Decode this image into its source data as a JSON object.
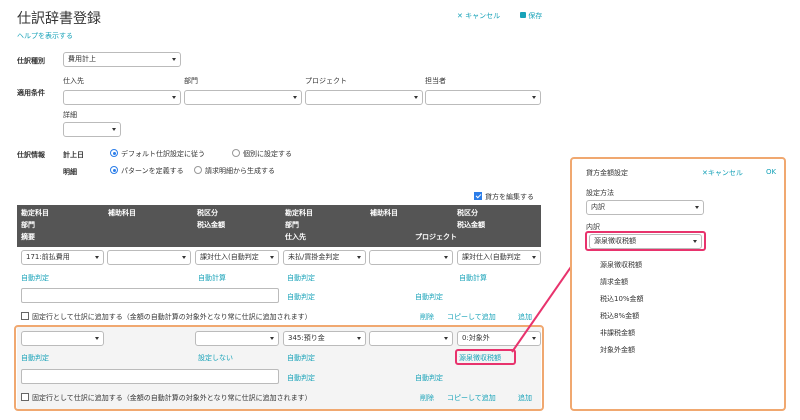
{
  "header": {
    "title": "仕訳辞書登録",
    "help_link": "ヘルプを表示する",
    "cancel_label": "キャンセル",
    "save_label": "保存"
  },
  "form": {
    "journal_type_label": "仕訳種別",
    "journal_type_value": "費用計上",
    "conditions_label": "適用条件",
    "supplier_label": "仕入先",
    "department_label": "部門",
    "project_label": "プロジェクト",
    "person_label": "担当者",
    "detail_label": "詳細",
    "info_label": "仕訳情報",
    "date_label": "計上日",
    "date_opt1": "デフォルト仕訳設定に従う",
    "date_opt2": "個別に設定する",
    "detail_row_label": "明細",
    "detail_opt1": "パターンを定義する",
    "detail_opt2": "請求明細から生成する",
    "edit_credit": "貸方を編集する"
  },
  "table_header": {
    "col1": [
      "勘定科目",
      "部門",
      "摘要"
    ],
    "col2": "補助科目",
    "col3": [
      "税区分",
      "税込金額"
    ],
    "col4": [
      "勘定科目",
      "部門",
      "仕入先"
    ],
    "col5": "補助科目",
    "col6": [
      "税区分",
      "税込金額"
    ],
    "project": "プロジェクト"
  },
  "row1": {
    "account": "171:前払費用",
    "tax": "課対仕入(自動判定",
    "credit_account": "未払/買掛金判定",
    "credit_tax": "課対仕入(自動判定",
    "auto_judge": "自動判定",
    "auto_calc": "自動計算",
    "credit_auto_judge": "自動判定",
    "credit_auto_calc": "自動計算",
    "auto_judge_2": "自動判定",
    "auto_judge_3": "自動判定",
    "fixed_row": "固定行として仕訳に追加する（金額の自動計算の対象外となり常に仕訳に追加されます）",
    "delete": "削除",
    "copy_add": "コピーして追加",
    "add": "追加"
  },
  "row2": {
    "credit_account": "345:預り金",
    "credit_tax": "0:対象外",
    "auto_judge": "自動判定",
    "no_setting": "設定しない",
    "credit_auto_judge": "自動判定",
    "withholding": "源泉徴収税額",
    "auto_judge_2": "自動判定",
    "auto_judge_3": "自動判定",
    "fixed_row": "固定行として仕訳に追加する（金額の自動計算の対象外となり常に仕訳に追加されます）",
    "delete": "削除",
    "copy_add": "コピーして追加",
    "add": "追加"
  },
  "panel": {
    "title": "貸方金額設定",
    "cancel": "キャンセル",
    "ok": "OK",
    "method_label": "設定方法",
    "method_value": "内訳",
    "breakdown_label": "内訳",
    "breakdown_value": "源泉徴収税額",
    "options": [
      "源泉徴収税額",
      "請求金額",
      "税込10%金額",
      "税込8%金額",
      "非課税金額",
      "対象外金額"
    ]
  },
  "colors": {
    "accent": "#17a2b8",
    "orange": "#f0a870",
    "pink": "#e8336d",
    "header_bg": "#555555"
  }
}
